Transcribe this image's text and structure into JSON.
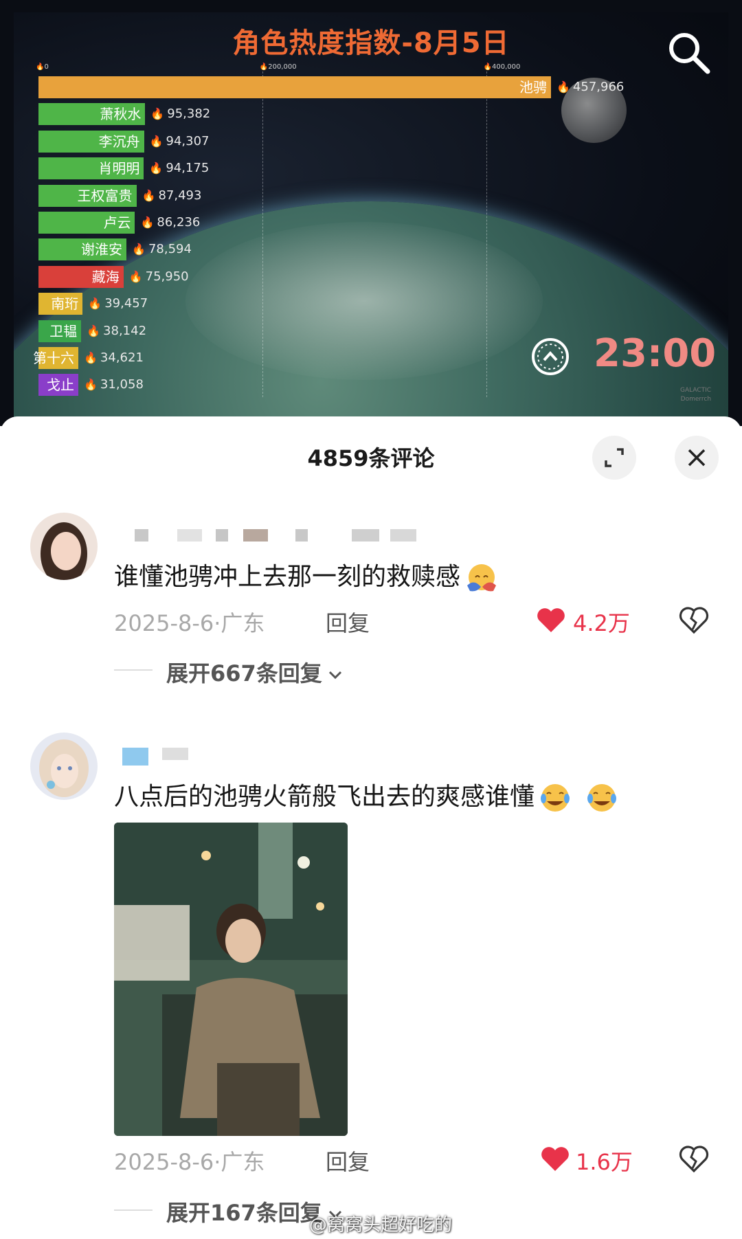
{
  "chart_data": {
    "type": "bar",
    "title": "角色热度指数-8月5日",
    "x_ticks": [
      "0",
      "200,000",
      "400,000"
    ],
    "xlim": [
      0,
      460000
    ],
    "categories": [
      "池骋",
      "萧秋水",
      "李沉舟",
      "肖明明",
      "王权富贵",
      "卢云",
      "谢淮安",
      "藏海",
      "南珩",
      "卫韫",
      "第十六",
      "戈止"
    ],
    "values": [
      457966,
      95382,
      94307,
      94175,
      87493,
      86236,
      78594,
      75950,
      39457,
      38142,
      34621,
      31058
    ],
    "value_labels": [
      "457,966",
      "95,382",
      "94,307",
      "94,175",
      "87,493",
      "86,236",
      "78,594",
      "75,950",
      "39,457",
      "38,142",
      "34,621",
      "31,058"
    ],
    "bar_colors": [
      "#e8a23c",
      "#4fb548",
      "#4fb548",
      "#4fb548",
      "#4fb548",
      "#4fb548",
      "#4fb548",
      "#d9403a",
      "#e0b531",
      "#3aa64a",
      "#e0b531",
      "#8a3ec9"
    ],
    "time": "23:00"
  },
  "video": {
    "watermark_small": [
      "GALACTIC",
      "Domerrch"
    ]
  },
  "comments_panel": {
    "title": "4859条评论",
    "comments": [
      {
        "text": "谁懂池骋冲上去那一刻的救赎感",
        "emoji": "hugging-face-icon",
        "date": "2025-8-6·广东",
        "reply": "回复",
        "likes": "4.2万",
        "expand": "展开667条回复"
      },
      {
        "text": "八点后的池骋火箭般飞出去的爽感谁懂",
        "emoji": "tears-of-joy-icon",
        "date": "2025-8-6·广东",
        "reply": "回复",
        "likes": "1.6万",
        "expand": "展开167条回复"
      }
    ]
  },
  "watermark": "@窝窝头超好吃的",
  "colors": {
    "title_orange": "#ef6a34",
    "time_pink": "#f08a84",
    "like_red": "#e8334a"
  }
}
